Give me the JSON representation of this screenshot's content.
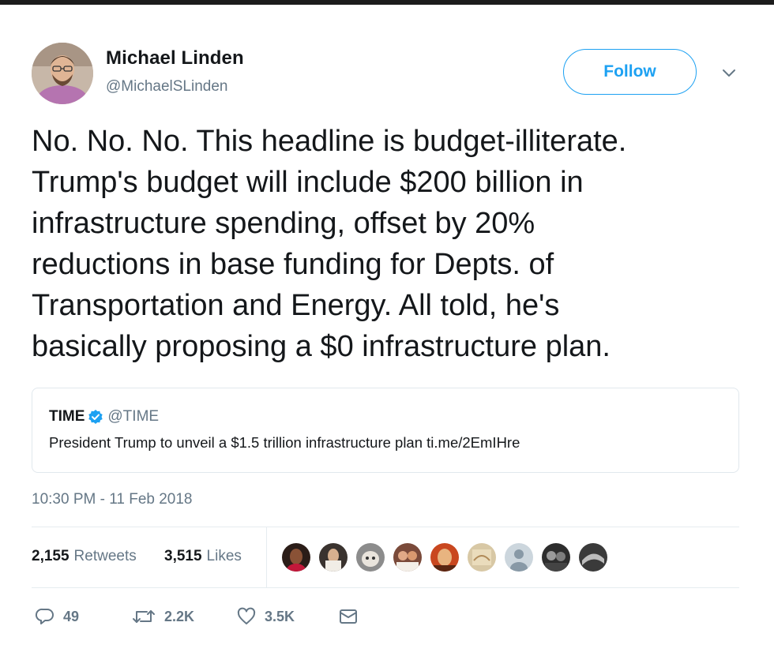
{
  "author": {
    "name": "Michael Linden",
    "handle": "@MichaelSLinden"
  },
  "follow_button": {
    "label": "Follow"
  },
  "tweet": {
    "lines": [
      "No. No. No. This headline is budget-illiterate.",
      "Trump's budget will include $200 billion in",
      "infrastructure spending, offset by 20%",
      "reductions in base funding for Depts. of",
      "Transportation and Energy. All told, he's",
      "basically proposing a $0 infrastructure plan."
    ]
  },
  "quoted_tweet": {
    "name": "TIME",
    "handle": "@TIME",
    "text": "President Trump to unveil a $1.5 trillion infrastructure plan ti.me/2EmIHre"
  },
  "timestamp": "10:30 PM - 11 Feb 2018",
  "stats": {
    "retweets_count": "2,155",
    "retweets_label": "Retweets",
    "likes_count": "3,515",
    "likes_label": "Likes"
  },
  "actions": {
    "reply_count": "49",
    "retweet_count": "2.2K",
    "like_count": "3.5K"
  },
  "icons": {
    "verified": "verified-badge-icon",
    "caret": "chevron-down-icon",
    "reply": "reply-icon",
    "retweet": "retweet-icon",
    "like": "heart-icon",
    "dm": "envelope-icon"
  },
  "colors": {
    "accent": "#1da1f2",
    "text": "#14171a",
    "muted": "#657786",
    "border": "#e1e8ed"
  }
}
